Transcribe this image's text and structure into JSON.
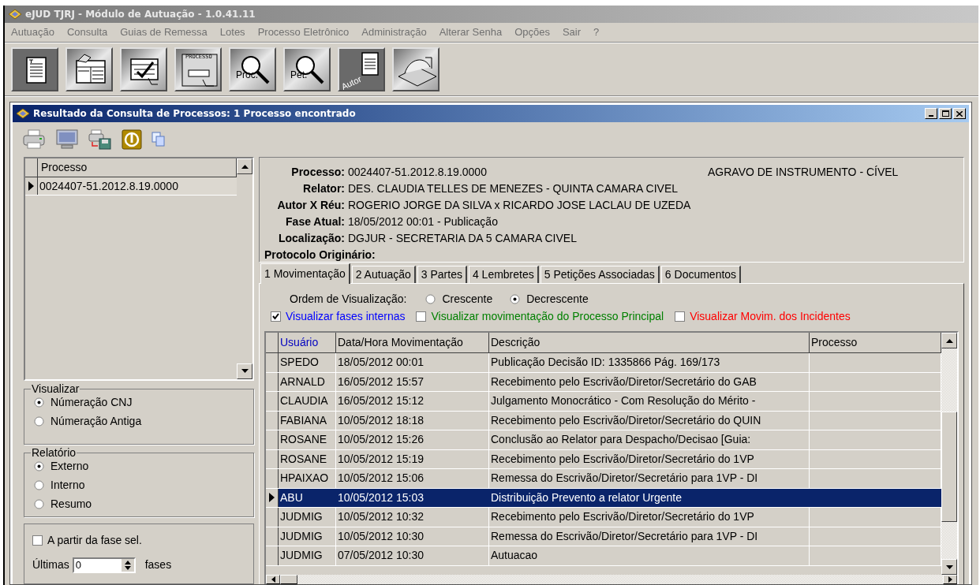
{
  "window": {
    "title": "eJUD TJRJ - Módulo de Autuação - 1.0.41.11"
  },
  "menu": [
    "Autuação",
    "Consulta",
    "Guias de Remessa",
    "Lotes",
    "Processo Eletrônico",
    "Administração",
    "Alterar Senha",
    "Opções",
    "Sair",
    "?"
  ],
  "toolbar": [
    {
      "kind": "document"
    },
    {
      "kind": "form"
    },
    {
      "kind": "checklist"
    },
    {
      "kind": "processo",
      "label": "PROCESSO"
    },
    {
      "kind": "search",
      "label": "Proc."
    },
    {
      "kind": "search",
      "label": "Pet."
    },
    {
      "kind": "autor",
      "label": "Autor"
    },
    {
      "kind": "scanner"
    }
  ],
  "dialog": {
    "title": "Resultado da Consulta de Processos: 1 Processo encontrado",
    "process_list": {
      "column": "Processo",
      "rows": [
        {
          "value": "0024407-51.2012.8.19.0000",
          "selected": true
        }
      ]
    },
    "visualizar": {
      "title": "Visualizar",
      "options": [
        {
          "label": "Númeração CNJ",
          "selected": true
        },
        {
          "label": "Númeração Antiga",
          "selected": false
        }
      ]
    },
    "relatorio": {
      "title": "Relatório",
      "options": [
        {
          "label": "Externo",
          "selected": true
        },
        {
          "label": "Interno",
          "selected": false
        },
        {
          "label": "Resumo",
          "selected": false
        }
      ]
    },
    "filter": {
      "label": "A partir da fase sel.",
      "checked": false,
      "ultimas_label": "Últimas",
      "value": "0",
      "unit": "fases"
    },
    "details": [
      {
        "label": "Processo:",
        "value": "0024407-51.2012.8.19.0000",
        "extra": "AGRAVO DE INSTRUMENTO - CÍVEL"
      },
      {
        "label": "Relator:",
        "value": "DES. CLAUDIA TELLES DE MENEZES - QUINTA CAMARA CIVEL"
      },
      {
        "label": "Autor X Réu:",
        "value": "ROGERIO JORGE DA SILVA x RICARDO JOSE LACLAU DE UZEDA"
      },
      {
        "label": "Fase Atual:",
        "value": "18/05/2012 00:01 - Publicação"
      },
      {
        "label": "Localização:",
        "value": "DGJUR - SECRETARIA DA 5 CAMARA CIVEL"
      },
      {
        "label": "Protocolo Originário:"
      }
    ],
    "tabs": [
      {
        "label": "1 Movimentação",
        "selected": true
      },
      {
        "label": "2 Autuação",
        "selected": false
      },
      {
        "label": "3 Partes",
        "selected": false
      },
      {
        "label": "4 Lembretes",
        "selected": false
      },
      {
        "label": "5 Petições Associadas",
        "selected": false
      },
      {
        "label": "6 Documentos",
        "selected": false
      }
    ],
    "ordem": {
      "label": "Ordem de Visualização:",
      "options": [
        {
          "label": "Crescente",
          "selected": false
        },
        {
          "label": "Decrescente",
          "selected": true
        }
      ]
    },
    "checks": [
      {
        "label": "Visualizar fases internas",
        "checked": true,
        "color": "#0000ff"
      },
      {
        "label": "Visualizar movimentação do Processo Principal",
        "checked": false,
        "color": "#008000"
      },
      {
        "label": "Visualizar Movim. dos Incidentes",
        "checked": false,
        "color": "#ff0000"
      }
    ],
    "grid": {
      "columns": [
        {
          "label": "Usuário",
          "sorted": true
        },
        {
          "label": "Data/Hora Movimentação",
          "sorted": false
        },
        {
          "label": "Descrição",
          "sorted": false
        },
        {
          "label": "Processo",
          "sorted": false
        }
      ],
      "rows": [
        {
          "cells": [
            "SPEDO",
            "18/05/2012 00:01",
            "Publicação Decisão ID: 1335866   Pág. 169/173",
            ""
          ],
          "selected": false
        },
        {
          "cells": [
            "ARNALD",
            "16/05/2012 15:57",
            "Recebimento pelo Escrivão/Diretor/Secretário do GAB",
            ""
          ],
          "selected": false
        },
        {
          "cells": [
            "CLAUDIA",
            "16/05/2012 15:12",
            "Julgamento Monocrático - Com Resolução do Mérito -",
            ""
          ],
          "selected": false
        },
        {
          "cells": [
            "FABIANA",
            "10/05/2012 18:18",
            "Recebimento pelo Escrivão/Diretor/Secretário do QUIN",
            ""
          ],
          "selected": false
        },
        {
          "cells": [
            "ROSANE",
            "10/05/2012 15:26",
            "Conclusão ao Relator para Despacho/Decisao  [Guia:",
            ""
          ],
          "selected": false
        },
        {
          "cells": [
            "ROSANE",
            "10/05/2012 15:19",
            "Recebimento pelo Escrivão/Diretor/Secretário do 1VP",
            ""
          ],
          "selected": false
        },
        {
          "cells": [
            "HPAIXAO",
            "10/05/2012 15:06",
            "Remessa do Escrivão/Diretor/Secretário para 1VP - DI",
            ""
          ],
          "selected": false
        },
        {
          "cells": [
            "ABU",
            "10/05/2012 15:03",
            "Distribuição Prevento a relator Urgente",
            ""
          ],
          "selected": true
        },
        {
          "cells": [
            "JUDMIG",
            "10/05/2012 10:32",
            "Recebimento pelo Escrivão/Diretor/Secretário do 1VP",
            ""
          ],
          "selected": false
        },
        {
          "cells": [
            "JUDMIG",
            "10/05/2012 10:30",
            "Remessa do Escrivão/Diretor/Secretário para 1VP - DI",
            ""
          ],
          "selected": false
        },
        {
          "cells": [
            "JUDMIG",
            "07/05/2012 10:30",
            "Autuacao",
            ""
          ],
          "selected": false
        }
      ]
    }
  }
}
